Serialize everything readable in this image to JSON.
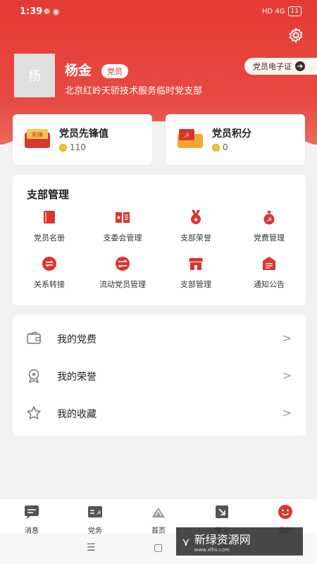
{
  "status": {
    "time": "1:39",
    "extra": "❁ ◉",
    "signal": "HD 4G",
    "battery": "11"
  },
  "profile": {
    "avatar_text": "杨",
    "name": "杨金",
    "badge": "党员",
    "org": "北京红岭天骄技术服务临时党支部",
    "cert_button": "党员电子证"
  },
  "stats": [
    {
      "title": "党员先锋值",
      "value": "110",
      "icon": "pioneer-icon"
    },
    {
      "title": "党员积分",
      "value": "0",
      "icon": "points-icon"
    }
  ],
  "management": {
    "title": "支部管理",
    "items": [
      {
        "label": "党员名册",
        "icon": "book-icon"
      },
      {
        "label": "支委会管理",
        "icon": "open-book-icon"
      },
      {
        "label": "支部荣誉",
        "icon": "medal-icon"
      },
      {
        "label": "党费管理",
        "icon": "moneybag-icon"
      },
      {
        "label": "关系转接",
        "icon": "transfer-icon"
      },
      {
        "label": "流动党员管理",
        "icon": "swap-icon"
      },
      {
        "label": "支部管理",
        "icon": "store-icon"
      },
      {
        "label": "通知公告",
        "icon": "notice-icon"
      }
    ]
  },
  "menu": [
    {
      "label": "我的党费",
      "icon": "wallet-icon"
    },
    {
      "label": "我的荣誉",
      "icon": "honor-icon"
    },
    {
      "label": "我的收藏",
      "icon": "star-icon"
    }
  ],
  "tabs": [
    {
      "label": "消息",
      "icon": "message-icon"
    },
    {
      "label": "党务",
      "icon": "party-affairs-icon"
    },
    {
      "label": "首页",
      "icon": "home-icon"
    },
    {
      "label": "学习",
      "icon": "study-icon"
    },
    {
      "label": "我的",
      "icon": "me-icon",
      "active": true
    }
  ],
  "watermark": {
    "text": "新绿资源网",
    "sub": "www.xlhs.com"
  },
  "colors": {
    "brand": "#e53a34",
    "active_tab": "#d8362f"
  }
}
